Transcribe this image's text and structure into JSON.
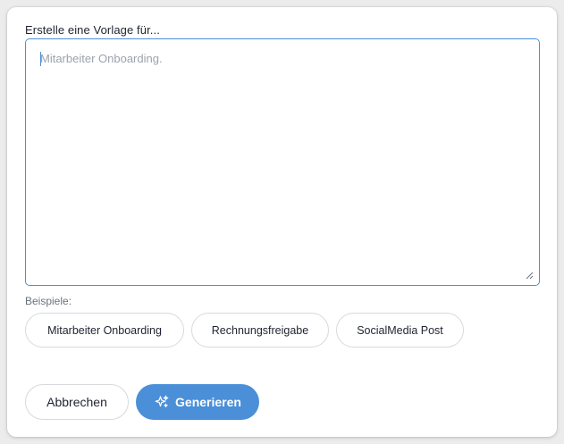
{
  "form": {
    "label": "Erstelle eine Vorlage für...",
    "textarea_value": "",
    "textarea_placeholder": "Mitarbeiter Onboarding."
  },
  "examples": {
    "label": "Beispiele:",
    "items": [
      "Mitarbeiter Onboarding",
      "Rechnungsfreigabe",
      "SocialMedia Post"
    ]
  },
  "actions": {
    "cancel_label": "Abbrechen",
    "generate_label": "Generieren",
    "generate_icon": "sparkles-icon"
  },
  "colors": {
    "accent": "#4a8fd8",
    "focus_border": "#4a90d9"
  }
}
